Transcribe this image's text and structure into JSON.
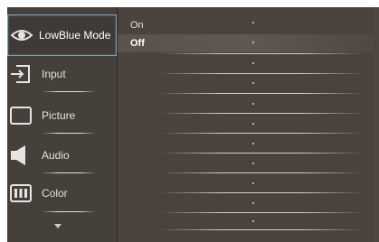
{
  "menu": {
    "items": [
      {
        "label": "LowBlue Mode",
        "icon": "eye-icon",
        "selected": true
      },
      {
        "label": "Input",
        "icon": "input-icon",
        "selected": false
      },
      {
        "label": "Picture",
        "icon": "picture-icon",
        "selected": false
      },
      {
        "label": "Audio",
        "icon": "speaker-icon",
        "selected": false
      },
      {
        "label": "Color",
        "icon": "color-icon",
        "selected": false
      }
    ],
    "more_icon": "chevron-down-icon"
  },
  "submenu": {
    "options": [
      {
        "label": "On",
        "selected": false
      },
      {
        "label": "Off",
        "selected": true
      }
    ]
  },
  "colors": {
    "panel_bg": "#4a423c",
    "highlight_border": "#7d9ccc",
    "text": "#e4e0dc"
  }
}
